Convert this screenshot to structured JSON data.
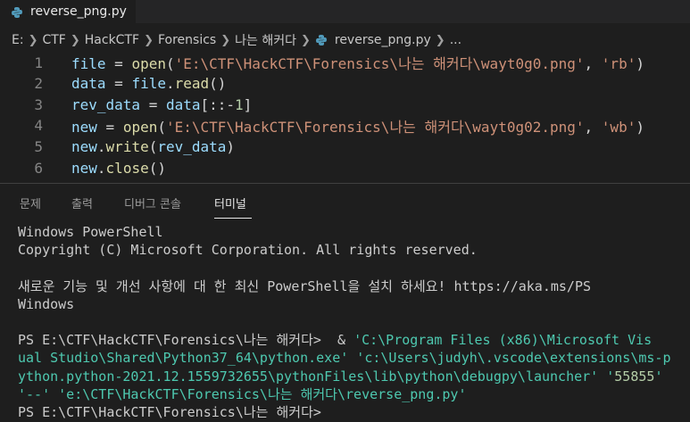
{
  "tab": {
    "title": "reverse_png.py"
  },
  "breadcrumb": {
    "items": [
      "E:",
      "CTF",
      "HackCTF",
      "Forensics",
      "나는 해커다",
      "reverse_png.py",
      "..."
    ]
  },
  "editor": {
    "lines": [
      {
        "number": "1",
        "parts": [
          {
            "t": "file",
            "c": "var"
          },
          {
            "t": " = ",
            "c": "pun"
          },
          {
            "t": "open",
            "c": "fn"
          },
          {
            "t": "(",
            "c": "pun"
          },
          {
            "t": "'E:\\CTF\\HackCTF\\Forensics\\나는 해커다\\wayt0g0.png'",
            "c": "str"
          },
          {
            "t": ", ",
            "c": "pun"
          },
          {
            "t": "'rb'",
            "c": "str"
          },
          {
            "t": ")",
            "c": "pun"
          }
        ]
      },
      {
        "number": "2",
        "parts": [
          {
            "t": "data",
            "c": "var"
          },
          {
            "t": " = ",
            "c": "pun"
          },
          {
            "t": "file",
            "c": "var"
          },
          {
            "t": ".",
            "c": "pun"
          },
          {
            "t": "read",
            "c": "fn"
          },
          {
            "t": "()",
            "c": "pun"
          }
        ]
      },
      {
        "number": "3",
        "parts": [
          {
            "t": "rev_data",
            "c": "var"
          },
          {
            "t": " = ",
            "c": "pun"
          },
          {
            "t": "data",
            "c": "var"
          },
          {
            "t": "[::-",
            "c": "pun"
          },
          {
            "t": "1",
            "c": "num"
          },
          {
            "t": "]",
            "c": "pun"
          }
        ]
      },
      {
        "number": "4",
        "parts": [
          {
            "t": "new",
            "c": "var"
          },
          {
            "t": " = ",
            "c": "pun"
          },
          {
            "t": "open",
            "c": "fn"
          },
          {
            "t": "(",
            "c": "pun"
          },
          {
            "t": "'E:\\CTF\\HackCTF\\Forensics\\나는 해커다\\wayt0g02.png'",
            "c": "str"
          },
          {
            "t": ", ",
            "c": "pun"
          },
          {
            "t": "'wb'",
            "c": "str"
          },
          {
            "t": ")",
            "c": "pun"
          }
        ]
      },
      {
        "number": "5",
        "parts": [
          {
            "t": "new",
            "c": "var"
          },
          {
            "t": ".",
            "c": "pun"
          },
          {
            "t": "write",
            "c": "fn"
          },
          {
            "t": "(",
            "c": "pun"
          },
          {
            "t": "rev_data",
            "c": "var"
          },
          {
            "t": ")",
            "c": "pun"
          }
        ]
      },
      {
        "number": "6",
        "parts": [
          {
            "t": "new",
            "c": "var"
          },
          {
            "t": ".",
            "c": "pun"
          },
          {
            "t": "close",
            "c": "fn"
          },
          {
            "t": "()",
            "c": "pun"
          }
        ]
      }
    ]
  },
  "panel": {
    "tabs": [
      "문제",
      "출력",
      "디버그 콘솔",
      "터미널"
    ],
    "active_tab": "터미널"
  },
  "terminal": {
    "lines": [
      [
        {
          "t": "Windows PowerShell",
          "c": ""
        }
      ],
      [
        {
          "t": "Copyright (C) Microsoft Corporation. All rights reserved.",
          "c": ""
        }
      ],
      [
        {
          "t": "",
          "c": ""
        }
      ],
      [
        {
          "t": "새로운 기능 및 개선 사항에 대 한 최신 PowerShell을 설치 하세요! https://aka.ms/PS",
          "c": ""
        }
      ],
      [
        {
          "t": "Windows",
          "c": ""
        }
      ],
      [
        {
          "t": "",
          "c": ""
        }
      ],
      [
        {
          "t": "PS E:\\CTF\\HackCTF\\Forensics\\나는 해커다>  ",
          "c": ""
        },
        {
          "t": "& ",
          "c": "cmd-amp"
        },
        {
          "t": "'C:\\Program Files (x86)\\Microsoft Vis",
          "c": "cmd-str"
        }
      ],
      [
        {
          "t": "ual Studio\\Shared\\Python37_64\\python.exe' 'c:\\Users\\judyh\\.vscode\\extensions\\ms-p",
          "c": "cmd-str"
        }
      ],
      [
        {
          "t": "ython.python-2021.12.1559732655\\pythonFiles\\lib\\python\\debugpy\\launcher' '",
          "c": "cmd-str"
        },
        {
          "t": "55855",
          "c": "cmd-num"
        },
        {
          "t": "'",
          "c": "cmd-str"
        }
      ],
      [
        {
          "t": "'--' 'e:\\CTF\\HackCTF\\Forensics\\나는 해커다\\reverse_png.py'",
          "c": "cmd-str"
        }
      ],
      [
        {
          "t": "PS E:\\CTF\\HackCTF\\Forensics\\나는 해커다>",
          "c": ""
        }
      ]
    ]
  },
  "colors": {
    "editor_bg": "#1e1e1e",
    "tabbar_bg": "#252526",
    "string": "#ce9178",
    "function": "#dcdcaa",
    "variable": "#9cdcfe",
    "terminal_string": "#4ec9b0"
  },
  "icons": {
    "tab_icon": "python-file-icon",
    "modified_indicator": "unsaved-dot-icon",
    "separator": "chevron-right-icon"
  }
}
